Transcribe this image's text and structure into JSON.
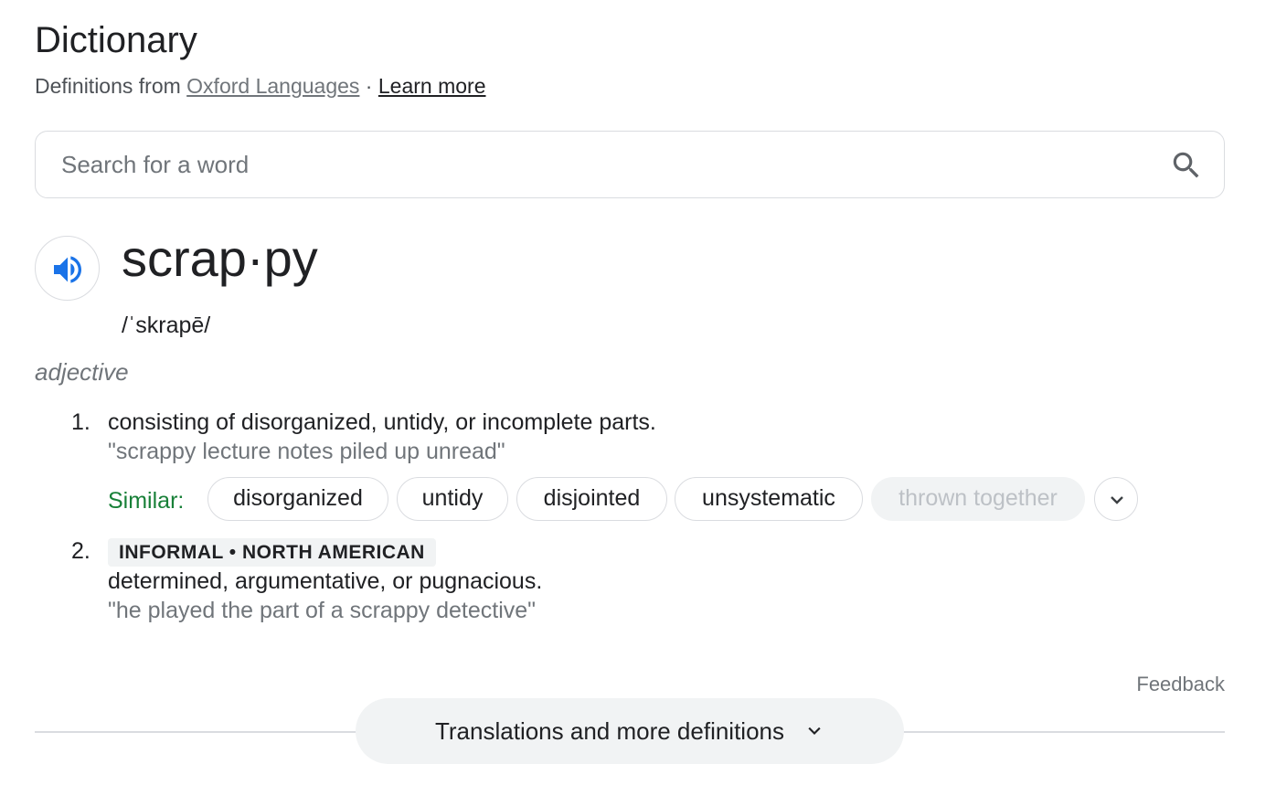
{
  "header": {
    "title": "Dictionary",
    "source_prefix": "Definitions from ",
    "source_link": "Oxford Languages",
    "separator": " · ",
    "learn_more": "Learn more"
  },
  "search": {
    "placeholder": "Search for a word",
    "value": "",
    "icon": "search-icon"
  },
  "entry": {
    "speaker_icon": "speaker-icon",
    "headword": "scrap·py",
    "pronunciation": "/ˈskrapē/",
    "part_of_speech": "adjective",
    "senses": [
      {
        "number": "1.",
        "definition": "consisting of disorganized, untidy, or incomplete parts.",
        "example": "\"scrappy lecture notes piled up unread\"",
        "similar_label": "Similar:",
        "similar": [
          "disorganized",
          "untidy",
          "disjointed",
          "unsystematic",
          "thrown together"
        ]
      },
      {
        "number": "2.",
        "register": "INFORMAL • NORTH AMERICAN",
        "definition": "determined, argumentative, or pugnacious.",
        "example": "\"he played the part of a scrappy detective\""
      }
    ]
  },
  "footer": {
    "feedback": "Feedback",
    "more_button": "Translations and more definitions"
  },
  "colors": {
    "accent_blue": "#1a73e8",
    "similar_green": "#188038",
    "border": "#dadce0",
    "muted_text": "#70757a"
  }
}
